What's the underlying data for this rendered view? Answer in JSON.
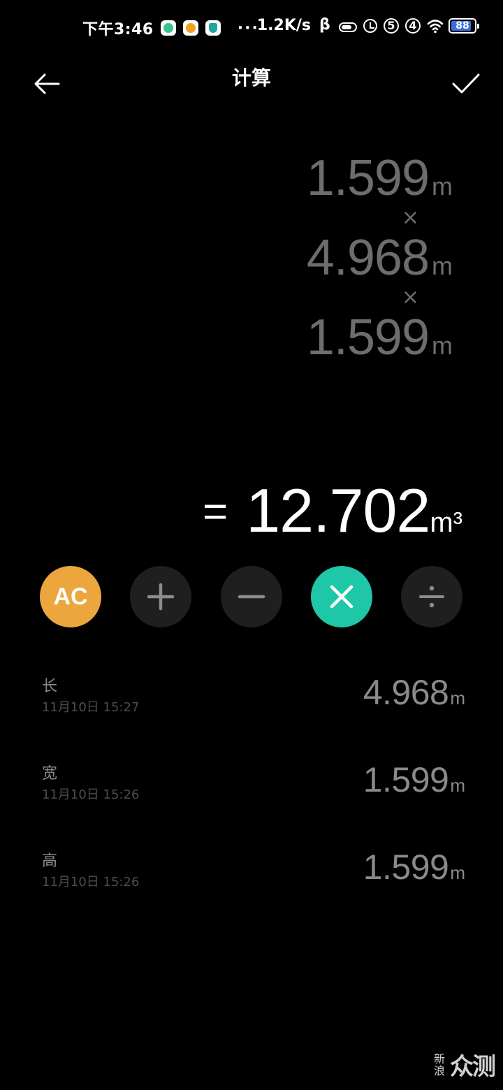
{
  "status_bar": {
    "time": "下午3:46",
    "more": "···",
    "net_speed": "1.2K/s",
    "signal_1": "5",
    "signal_2": "4",
    "battery_level": 88,
    "battery_text": "88"
  },
  "header": {
    "title": "计算",
    "back_icon": "arrow-left-icon",
    "confirm_icon": "check-icon"
  },
  "expression": {
    "operands": [
      {
        "value": "1.599",
        "unit": "m"
      },
      {
        "value": "4.968",
        "unit": "m"
      },
      {
        "value": "1.599",
        "unit": "m"
      }
    ],
    "operators": [
      "×",
      "×"
    ]
  },
  "result": {
    "eq": "=",
    "value": "12.702",
    "unit": "m³"
  },
  "buttons": {
    "ac_label": "AC",
    "ac_color": "#eda63d",
    "active_color": "#1ec7a7",
    "active_op": "multiply",
    "ops": [
      "plus",
      "minus",
      "multiply",
      "divide"
    ]
  },
  "history": [
    {
      "label": "长",
      "time": "11月10日 15:27",
      "value": "4.968",
      "unit": "m"
    },
    {
      "label": "宽",
      "time": "11月10日 15:26",
      "value": "1.599",
      "unit": "m"
    },
    {
      "label": "高",
      "time": "11月10日 15:26",
      "value": "1.599",
      "unit": "m"
    }
  ],
  "watermark": {
    "small_top": "新",
    "small_bottom": "浪",
    "big": "众测"
  }
}
